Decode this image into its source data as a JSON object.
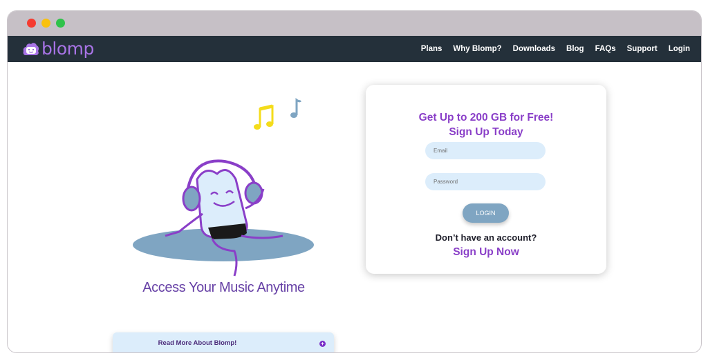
{
  "window": {
    "controls": [
      "close",
      "minimize",
      "maximize"
    ]
  },
  "navbar": {
    "logo_text": "blomp",
    "links": [
      "Plans",
      "Why Blomp?",
      "Downloads",
      "Blog",
      "FAQs",
      "Support",
      "Login"
    ]
  },
  "hero": {
    "tagline": "Access Your Music Anytime",
    "read_more_label": "Read More About Blomp!",
    "read_more_icon": "plus-circle-icon"
  },
  "signup_card": {
    "heading_line1": "Get Up to 200 GB for Free!",
    "heading_line2": "Sign Up Today",
    "email_placeholder": "Email",
    "password_placeholder": "Password",
    "login_label": "LOGIN",
    "no_account_text": "Don’t have an account?",
    "signup_link": "Sign Up Now"
  },
  "colors": {
    "navbar_bg": "#24303a",
    "brand_purple": "#8a3fc8",
    "field_bg": "#dcedfb",
    "login_button": "#7fa5c2",
    "note_yellow": "#f4dc1b",
    "note_blue": "#7fa5c2"
  }
}
